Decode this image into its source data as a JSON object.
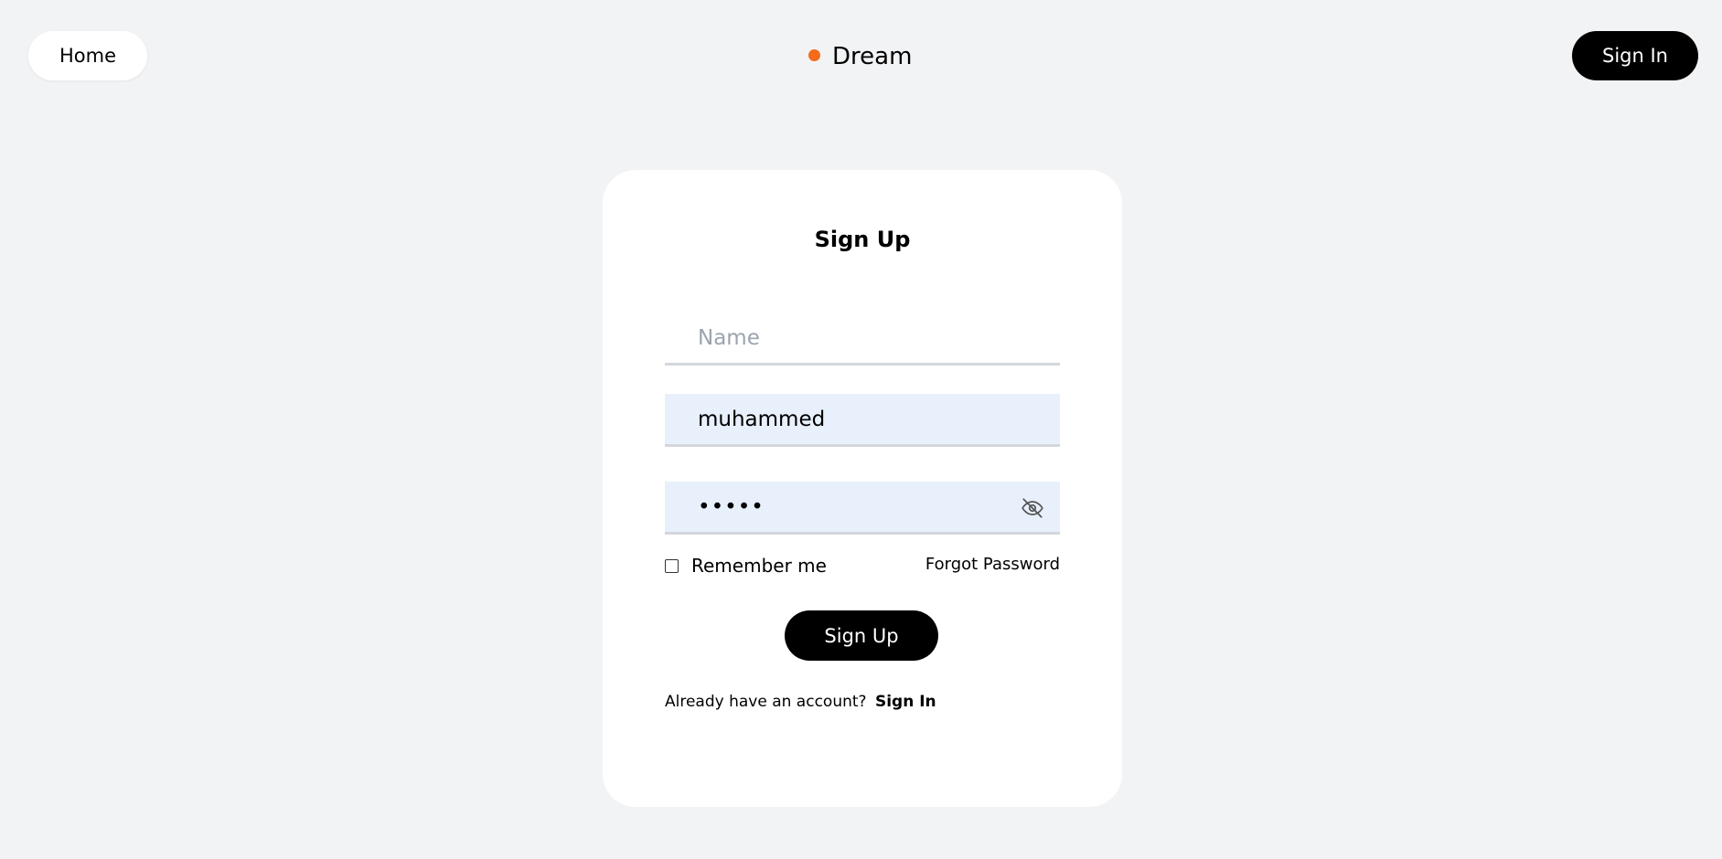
{
  "header": {
    "home_label": "Home",
    "brand_name": "Dream",
    "brand_dot_color": "#f26c1b",
    "signin_label": "Sign In"
  },
  "form": {
    "title": "Sign Up",
    "name_placeholder": "Name",
    "name_value": "",
    "email_value": "muhammed",
    "password_value": "•••••",
    "password_toggle_icon": "eye-off-icon",
    "field_fill_color": "#e8f0fc",
    "remember_label": "Remember me",
    "remember_checked": false,
    "forgot_label": "Forgot Password",
    "submit_label": "Sign Up",
    "footer_text": "Already have an account?",
    "footer_link": "Sign In"
  }
}
